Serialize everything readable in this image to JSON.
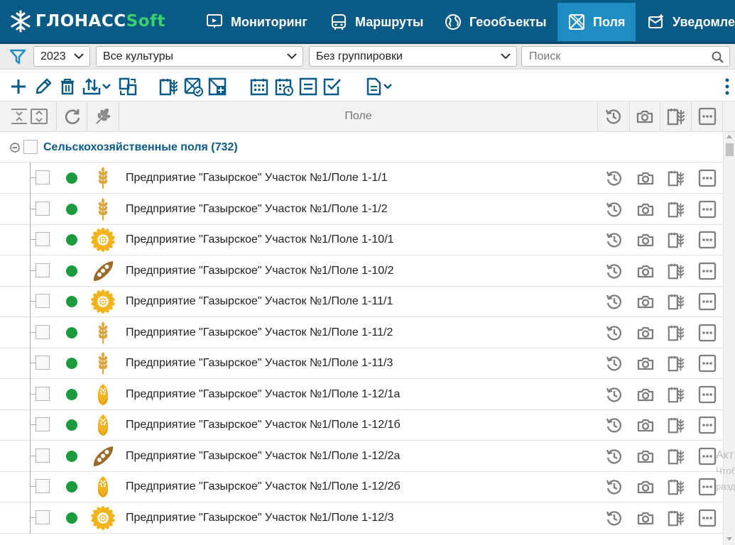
{
  "app": {
    "logo_main": "ГЛОНАСС",
    "logo_accent": "Soft"
  },
  "nav": {
    "tabs": [
      {
        "label": "Мониторинг",
        "icon": "monitor-icon",
        "active": false
      },
      {
        "label": "Маршруты",
        "icon": "bus-icon",
        "active": false
      },
      {
        "label": "Геообъекты",
        "icon": "globe-icon",
        "active": false
      },
      {
        "label": "Поля",
        "icon": "field-icon",
        "active": true
      },
      {
        "label": "Уведомле",
        "icon": "mail-icon",
        "active": false
      }
    ]
  },
  "filters": {
    "year": "2023",
    "crops": "Все культуры",
    "grouping": "Без группировки",
    "search_placeholder": "Поиск"
  },
  "toolbar": {
    "icons": [
      "add-icon",
      "edit-icon",
      "delete-icon",
      "import-export-icon",
      "copy-icon",
      "field-crop-icon",
      "field-check-icon",
      "field-add-icon",
      "calendar-icon",
      "calendar-clock-icon",
      "list-icon",
      "checkmark-icon",
      "report-icon",
      "more-vertical-icon"
    ]
  },
  "columns": {
    "field_title": "Поле"
  },
  "group": {
    "label": "Сельскохозяйственные поля (732)"
  },
  "rows": [
    {
      "name": "Предприятие \"Газырское\" Участок №1/Поле 1-1/1",
      "crop": "wheat",
      "status": "active"
    },
    {
      "name": "Предприятие \"Газырское\" Участок №1/Поле 1-1/2",
      "crop": "wheat",
      "status": "active"
    },
    {
      "name": "Предприятие \"Газырское\" Участок №1/Поле 1-10/1",
      "crop": "sunflower",
      "status": "active"
    },
    {
      "name": "Предприятие \"Газырское\" Участок №1/Поле 1-10/2",
      "crop": "soy",
      "status": "active"
    },
    {
      "name": "Предприятие \"Газырское\" Участок №1/Поле 1-11/1",
      "crop": "sunflower",
      "status": "active"
    },
    {
      "name": "Предприятие \"Газырское\" Участок №1/Поле 1-11/2",
      "crop": "wheat",
      "status": "active"
    },
    {
      "name": "Предприятие \"Газырское\" Участок №1/Поле 1-11/3",
      "crop": "wheat",
      "status": "active"
    },
    {
      "name": "Предприятие \"Газырское\" Участок №1/Поле 1-12/1а",
      "crop": "corn",
      "status": "active"
    },
    {
      "name": "Предприятие \"Газырское\" Участок №1/Поле 1-12/1б",
      "crop": "corn",
      "status": "active"
    },
    {
      "name": "Предприятие \"Газырское\" Участок №1/Поле 1-12/2а",
      "crop": "soy",
      "status": "active"
    },
    {
      "name": "Предприятие \"Газырское\" Участок №1/Поле 1-12/2б",
      "crop": "corn",
      "status": "active"
    },
    {
      "name": "Предприятие \"Газырское\" Участок №1/Поле 1-12/3",
      "crop": "sunflower",
      "status": "active"
    }
  ],
  "row_actions": [
    "history-icon",
    "camera-icon",
    "field-crop-icon",
    "more-options-icon"
  ],
  "watermark": {
    "line1": "Акт",
    "line2": "Чтоб",
    "line3": "разд"
  },
  "colors": {
    "nav_bg": "#0a5a86",
    "nav_active": "#1f8cc4",
    "accent_green": "#38d16a",
    "status_active": "#1c9a3e",
    "icon_blue": "#0a5a86"
  }
}
